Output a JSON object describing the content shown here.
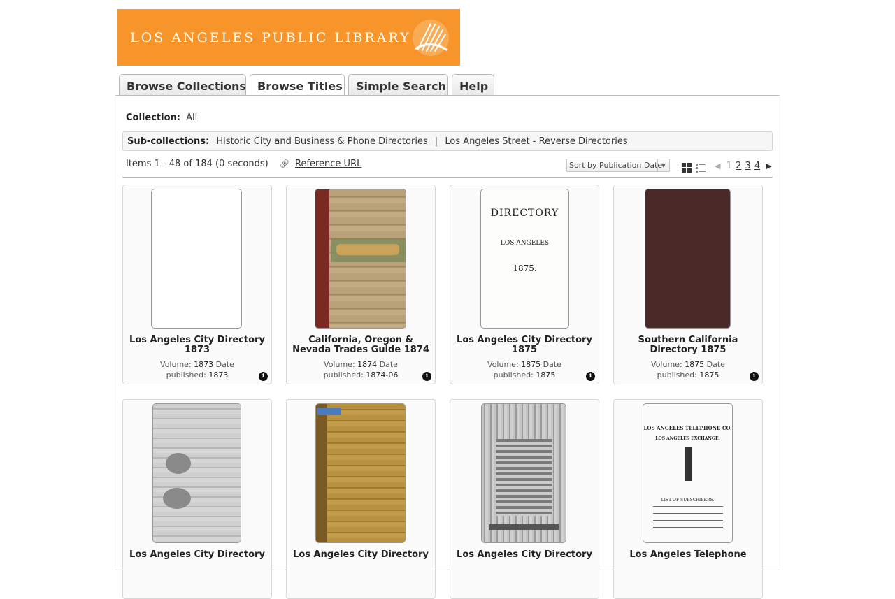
{
  "header": {
    "brand": "LOS ANGELES PUBLIC LIBRARY"
  },
  "tabs": [
    {
      "label": "Browse Collections",
      "active": false
    },
    {
      "label": "Browse Titles",
      "active": true
    },
    {
      "label": "Simple Search",
      "active": false
    },
    {
      "label": "Help",
      "active": false
    }
  ],
  "collection": {
    "label": "Collection:",
    "value": "All"
  },
  "subcollections": {
    "label": "Sub-collections:",
    "items": [
      "Historic City and Business & Phone Directories",
      "Los Angeles Street - Reverse Directories"
    ],
    "separator": "|"
  },
  "results": {
    "summary": "Items 1 - 48 of 184 (0 seconds)",
    "reference_label": "Reference URL"
  },
  "sort": {
    "selected": "Sort by Publication Date"
  },
  "pagination": {
    "current": "1",
    "pages": [
      "2",
      "3",
      "4"
    ]
  },
  "meta_labels": {
    "volume": "Volume:",
    "date": "Date published:"
  },
  "items": [
    {
      "title": "Los Angeles City Directory 1873",
      "volume": "1873",
      "date": "1873",
      "cover": "blank"
    },
    {
      "title": "California, Oregon & Nevada Trades Guide 1874",
      "volume": "1874",
      "date": "1874-06",
      "cover": "tan-spine"
    },
    {
      "title": "Los Angeles City Directory 1875",
      "volume": "1875",
      "date": "1875",
      "cover": "print"
    },
    {
      "title": "Southern California Directory 1875",
      "volume": "1875",
      "date": "1875",
      "cover": "brown"
    },
    {
      "title": "Los Angeles City Directory",
      "cover": "grey-print"
    },
    {
      "title": "Los Angeles City Directory",
      "cover": "yellow"
    },
    {
      "title": "Los Angeles City Directory",
      "cover": "engraving"
    },
    {
      "title": "Los Angeles Telephone",
      "cover": "telephone"
    }
  ],
  "cover_text": {
    "c3_lines": [
      "DIRECTORY",
      "LOS ANGELES",
      "1875."
    ],
    "c8_lines": [
      "LOS ANGELES TELEPHONE CO.",
      "LOS ANGELES EXCHANGE.",
      "LIST OF SUBSCRIBERS."
    ]
  },
  "colors": {
    "brand_orange": "#f7952b",
    "panel_border": "#bcbcbc",
    "cover_brown": "#4a2a28"
  }
}
